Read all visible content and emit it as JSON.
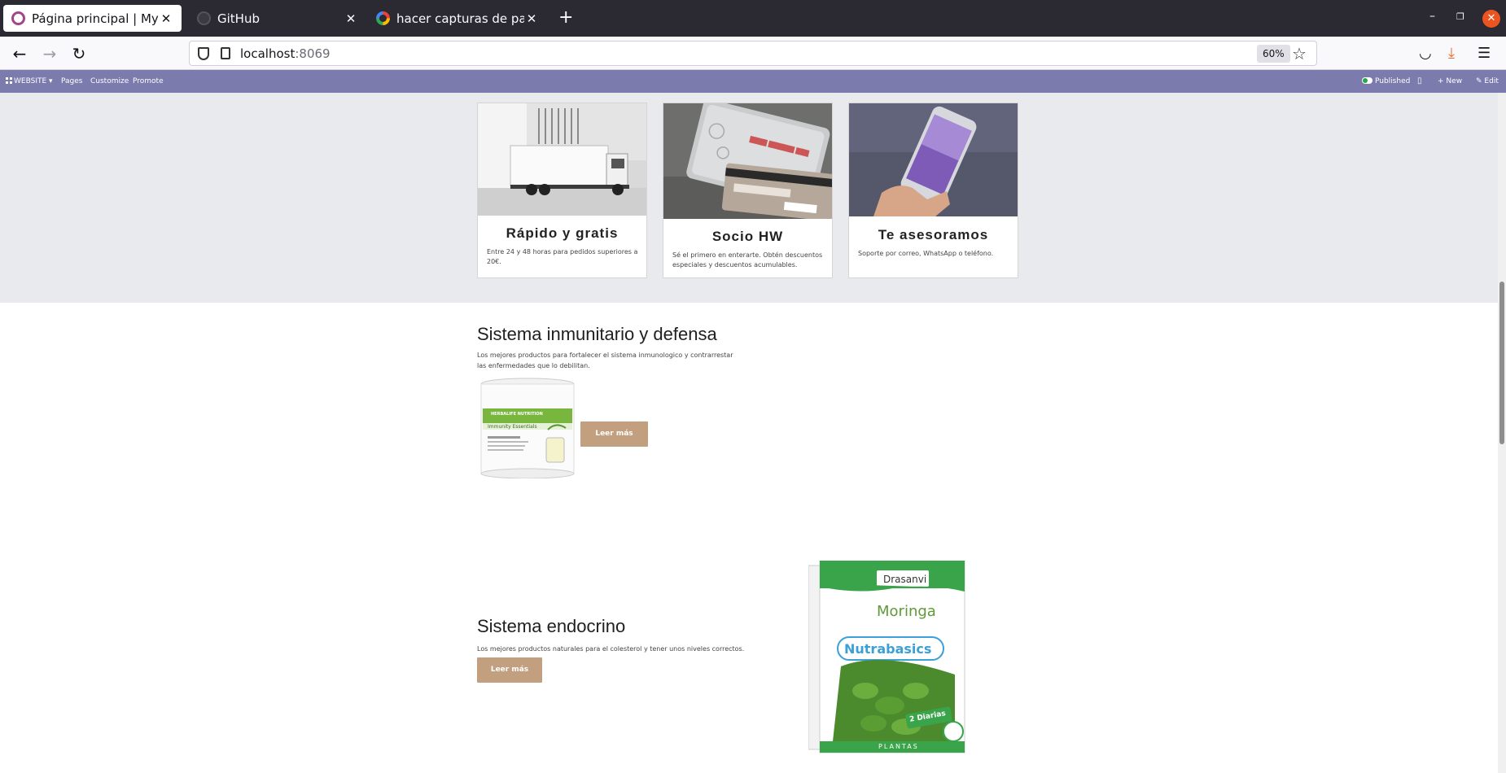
{
  "browser": {
    "tabs": [
      {
        "title": "Página principal | My Web",
        "active": true
      },
      {
        "title": "GitHub",
        "active": false
      },
      {
        "title": "hacer capturas de pantall",
        "active": false
      }
    ],
    "url_host": "localhost",
    "url_port": ":8069",
    "zoom": "60%"
  },
  "odoo_bar": {
    "app": "WEBSITE",
    "menu": [
      "Pages",
      "Customize",
      "Promote"
    ],
    "published": "Published",
    "new": "New",
    "edit": "Edit"
  },
  "features": [
    {
      "title": "Rápido y gratis",
      "text": "Entre 24 y 48 horas para pedidos superiores a 20€."
    },
    {
      "title": "Socio HW",
      "text": "Sé el primero en enterarte. Obtén descuentos especiales y descuentos acumulables."
    },
    {
      "title": "Te asesoramos",
      "text": "Soporte por correo, WhatsApp o teléfono."
    }
  ],
  "section_inmune": {
    "title": "Sistema inmunitario y defensa",
    "text": "Los mejores productos para fortalecer el sistema inmunologico y contrarrestar las enfermedades que lo debilitan.",
    "button": "Leer más",
    "product_brand": "HERBALIFE NUTRITION",
    "product_name": "Immunity Essentials"
  },
  "section_endocrino": {
    "title": "Sistema endocrino",
    "text": "Los mejores productos naturales para el colesterol  y tener unos niveles correctos.",
    "button": "Leer más",
    "product_brand": "Drasanvi",
    "product_name": "Moringa",
    "product_line": "Nutrabasics",
    "product_badge": "2 Diarias",
    "product_footer": "PLANTAS"
  },
  "colors": {
    "odoo_bar": "#7c7bad",
    "button": "#c2a07f",
    "band": "#e8eaee"
  }
}
